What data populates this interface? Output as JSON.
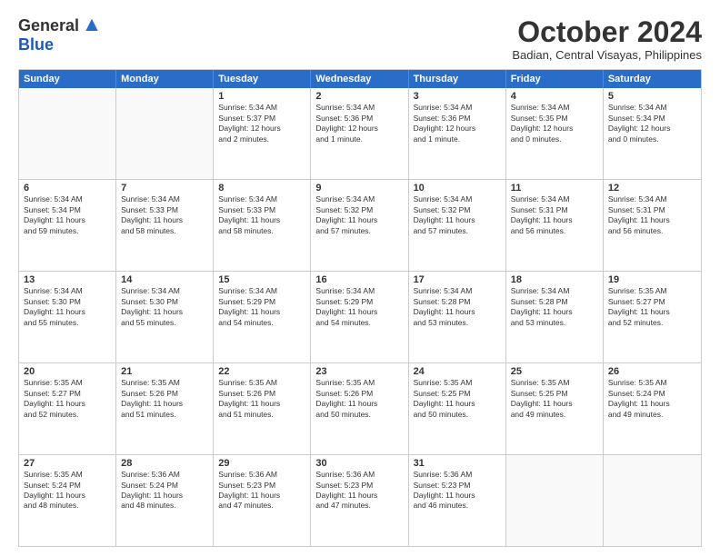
{
  "header": {
    "logo_general": "General",
    "logo_blue": "Blue",
    "title": "October 2024",
    "location": "Badian, Central Visayas, Philippines"
  },
  "days_of_week": [
    "Sunday",
    "Monday",
    "Tuesday",
    "Wednesday",
    "Thursday",
    "Friday",
    "Saturday"
  ],
  "weeks": [
    [
      {
        "day": "",
        "info": ""
      },
      {
        "day": "",
        "info": ""
      },
      {
        "day": "1",
        "info": "Sunrise: 5:34 AM\nSunset: 5:37 PM\nDaylight: 12 hours\nand 2 minutes."
      },
      {
        "day": "2",
        "info": "Sunrise: 5:34 AM\nSunset: 5:36 PM\nDaylight: 12 hours\nand 1 minute."
      },
      {
        "day": "3",
        "info": "Sunrise: 5:34 AM\nSunset: 5:36 PM\nDaylight: 12 hours\nand 1 minute."
      },
      {
        "day": "4",
        "info": "Sunrise: 5:34 AM\nSunset: 5:35 PM\nDaylight: 12 hours\nand 0 minutes."
      },
      {
        "day": "5",
        "info": "Sunrise: 5:34 AM\nSunset: 5:34 PM\nDaylight: 12 hours\nand 0 minutes."
      }
    ],
    [
      {
        "day": "6",
        "info": "Sunrise: 5:34 AM\nSunset: 5:34 PM\nDaylight: 11 hours\nand 59 minutes."
      },
      {
        "day": "7",
        "info": "Sunrise: 5:34 AM\nSunset: 5:33 PM\nDaylight: 11 hours\nand 58 minutes."
      },
      {
        "day": "8",
        "info": "Sunrise: 5:34 AM\nSunset: 5:33 PM\nDaylight: 11 hours\nand 58 minutes."
      },
      {
        "day": "9",
        "info": "Sunrise: 5:34 AM\nSunset: 5:32 PM\nDaylight: 11 hours\nand 57 minutes."
      },
      {
        "day": "10",
        "info": "Sunrise: 5:34 AM\nSunset: 5:32 PM\nDaylight: 11 hours\nand 57 minutes."
      },
      {
        "day": "11",
        "info": "Sunrise: 5:34 AM\nSunset: 5:31 PM\nDaylight: 11 hours\nand 56 minutes."
      },
      {
        "day": "12",
        "info": "Sunrise: 5:34 AM\nSunset: 5:31 PM\nDaylight: 11 hours\nand 56 minutes."
      }
    ],
    [
      {
        "day": "13",
        "info": "Sunrise: 5:34 AM\nSunset: 5:30 PM\nDaylight: 11 hours\nand 55 minutes."
      },
      {
        "day": "14",
        "info": "Sunrise: 5:34 AM\nSunset: 5:30 PM\nDaylight: 11 hours\nand 55 minutes."
      },
      {
        "day": "15",
        "info": "Sunrise: 5:34 AM\nSunset: 5:29 PM\nDaylight: 11 hours\nand 54 minutes."
      },
      {
        "day": "16",
        "info": "Sunrise: 5:34 AM\nSunset: 5:29 PM\nDaylight: 11 hours\nand 54 minutes."
      },
      {
        "day": "17",
        "info": "Sunrise: 5:34 AM\nSunset: 5:28 PM\nDaylight: 11 hours\nand 53 minutes."
      },
      {
        "day": "18",
        "info": "Sunrise: 5:34 AM\nSunset: 5:28 PM\nDaylight: 11 hours\nand 53 minutes."
      },
      {
        "day": "19",
        "info": "Sunrise: 5:35 AM\nSunset: 5:27 PM\nDaylight: 11 hours\nand 52 minutes."
      }
    ],
    [
      {
        "day": "20",
        "info": "Sunrise: 5:35 AM\nSunset: 5:27 PM\nDaylight: 11 hours\nand 52 minutes."
      },
      {
        "day": "21",
        "info": "Sunrise: 5:35 AM\nSunset: 5:26 PM\nDaylight: 11 hours\nand 51 minutes."
      },
      {
        "day": "22",
        "info": "Sunrise: 5:35 AM\nSunset: 5:26 PM\nDaylight: 11 hours\nand 51 minutes."
      },
      {
        "day": "23",
        "info": "Sunrise: 5:35 AM\nSunset: 5:26 PM\nDaylight: 11 hours\nand 50 minutes."
      },
      {
        "day": "24",
        "info": "Sunrise: 5:35 AM\nSunset: 5:25 PM\nDaylight: 11 hours\nand 50 minutes."
      },
      {
        "day": "25",
        "info": "Sunrise: 5:35 AM\nSunset: 5:25 PM\nDaylight: 11 hours\nand 49 minutes."
      },
      {
        "day": "26",
        "info": "Sunrise: 5:35 AM\nSunset: 5:24 PM\nDaylight: 11 hours\nand 49 minutes."
      }
    ],
    [
      {
        "day": "27",
        "info": "Sunrise: 5:35 AM\nSunset: 5:24 PM\nDaylight: 11 hours\nand 48 minutes."
      },
      {
        "day": "28",
        "info": "Sunrise: 5:36 AM\nSunset: 5:24 PM\nDaylight: 11 hours\nand 48 minutes."
      },
      {
        "day": "29",
        "info": "Sunrise: 5:36 AM\nSunset: 5:23 PM\nDaylight: 11 hours\nand 47 minutes."
      },
      {
        "day": "30",
        "info": "Sunrise: 5:36 AM\nSunset: 5:23 PM\nDaylight: 11 hours\nand 47 minutes."
      },
      {
        "day": "31",
        "info": "Sunrise: 5:36 AM\nSunset: 5:23 PM\nDaylight: 11 hours\nand 46 minutes."
      },
      {
        "day": "",
        "info": ""
      },
      {
        "day": "",
        "info": ""
      }
    ]
  ]
}
